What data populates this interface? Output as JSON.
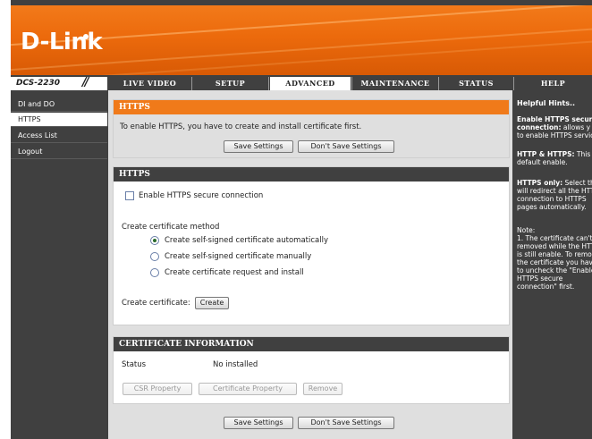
{
  "brand": {
    "logo_text": "D-Link",
    "model": "DCS-2230"
  },
  "nav": {
    "tabs": [
      "LIVE VIDEO",
      "SETUP",
      "ADVANCED",
      "MAINTENANCE",
      "STATUS",
      "HELP"
    ],
    "active": "ADVANCED"
  },
  "sidebar": {
    "items": [
      "DI and DO",
      "HTTPS",
      "Access List",
      "Logout"
    ],
    "active": "HTTPS"
  },
  "intro": {
    "title": "HTTPS",
    "text": "To enable HTTPS, you have to create and install certificate first.",
    "save_label": "Save Settings",
    "dont_save_label": "Don't Save Settings"
  },
  "https": {
    "title": "HTTPS",
    "enable_label": "Enable HTTPS secure connection",
    "method_label": "Create certificate method",
    "options": [
      "Create self-signed certificate automatically",
      "Create self-signed certificate manually",
      "Create certificate request and install"
    ],
    "selected_option": 0,
    "create_label": "Create certificate:",
    "create_button": "Create"
  },
  "certificate": {
    "title": "CERTIFICATE INFORMATION",
    "status_label": "Status",
    "status_value": "No installed",
    "buttons": [
      "CSR Property",
      "Certificate Property",
      "Remove"
    ]
  },
  "footer": {
    "save_label": "Save Settings",
    "dont_save_label": "Don't Save Settings"
  },
  "help": {
    "title": "Helpful Hints..",
    "lines": [
      {
        "bold": "Enable HTTPS secur",
        "text": ""
      },
      {
        "bold": "connection:",
        "text": " allows y"
      },
      {
        "bold": "",
        "text": "to enable HTTPS servic"
      },
      {
        "bold": "HTTP & HTTPS:",
        "text": " This"
      },
      {
        "bold": "",
        "text": "default enable."
      },
      {
        "bold": "HTTPS only:",
        "text": " Select th"
      },
      {
        "bold": "",
        "text": "will redirect all the HTTP"
      },
      {
        "bold": "",
        "text": "connection to HTTPS"
      },
      {
        "bold": "",
        "text": "pages automatically."
      },
      {
        "bold": "",
        "text": "Note:"
      },
      {
        "bold": "",
        "text": "1. The certificate can't"
      },
      {
        "bold": "",
        "text": "removed while the HTTP"
      },
      {
        "bold": "",
        "text": "is still enable. To remov"
      },
      {
        "bold": "",
        "text": "the certificate you have"
      },
      {
        "bold": "",
        "text": "to uncheck the \"Enable"
      },
      {
        "bold": "",
        "text": "HTTPS secure"
      },
      {
        "bold": "",
        "text": "connection\" first."
      }
    ]
  }
}
